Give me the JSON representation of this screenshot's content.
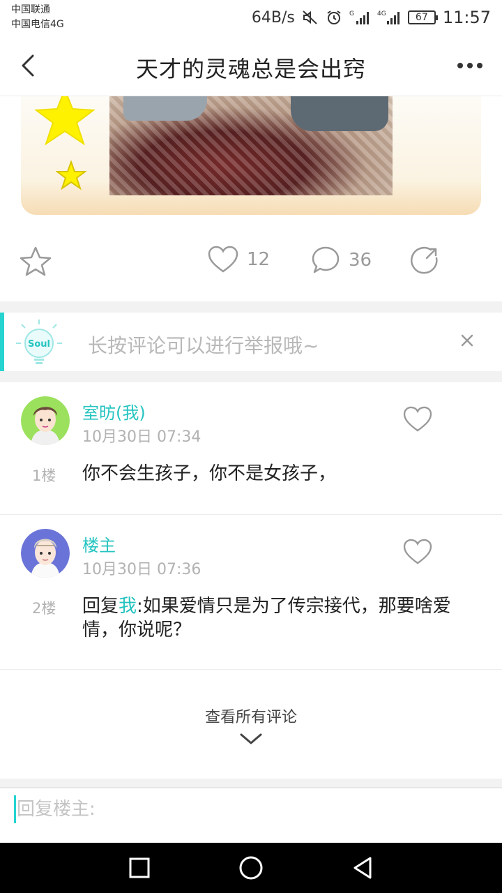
{
  "status_bar": {
    "carrier_1": "中国联通",
    "carrier_2": "中国电信4G",
    "net_speed": "64B/s",
    "battery": "67",
    "time": "11:57",
    "icons": [
      "mute-icon",
      "alarm-icon",
      "signal-g-icon",
      "signal-4g-icon",
      "battery-icon"
    ]
  },
  "header": {
    "title": "天才的灵魂总是会出窍",
    "back_icon": "chevron-left-icon",
    "more_icon": "more-dots-icon"
  },
  "actions": {
    "like_count": "12",
    "comment_count": "36",
    "icons": [
      "star-icon",
      "heart-icon",
      "comment-bubble-icon",
      "share-icon"
    ]
  },
  "tip": {
    "badge": "Soul",
    "text": "长按评论可以进行举报哦~",
    "close_icon": "close-icon"
  },
  "comments": [
    {
      "name": "室昉(我)",
      "time": "10月30日 07:34",
      "floor": "1楼",
      "text": "你不会生孩子，你不是女孩子，"
    },
    {
      "name": "楼主",
      "time": "10月30日 07:36",
      "floor": "2楼",
      "reply_prefix": "回复",
      "reply_target": "我",
      "text": ":如果爱情只是为了传宗接代，那要啥爱情，你说呢？"
    }
  ],
  "view_all": {
    "label": "查看所有评论"
  },
  "reply": {
    "placeholder": "回复楼主:"
  },
  "colors": {
    "accent": "#25d4d0",
    "name_color": "#25c4c0",
    "muted": "#b2b2b2"
  }
}
